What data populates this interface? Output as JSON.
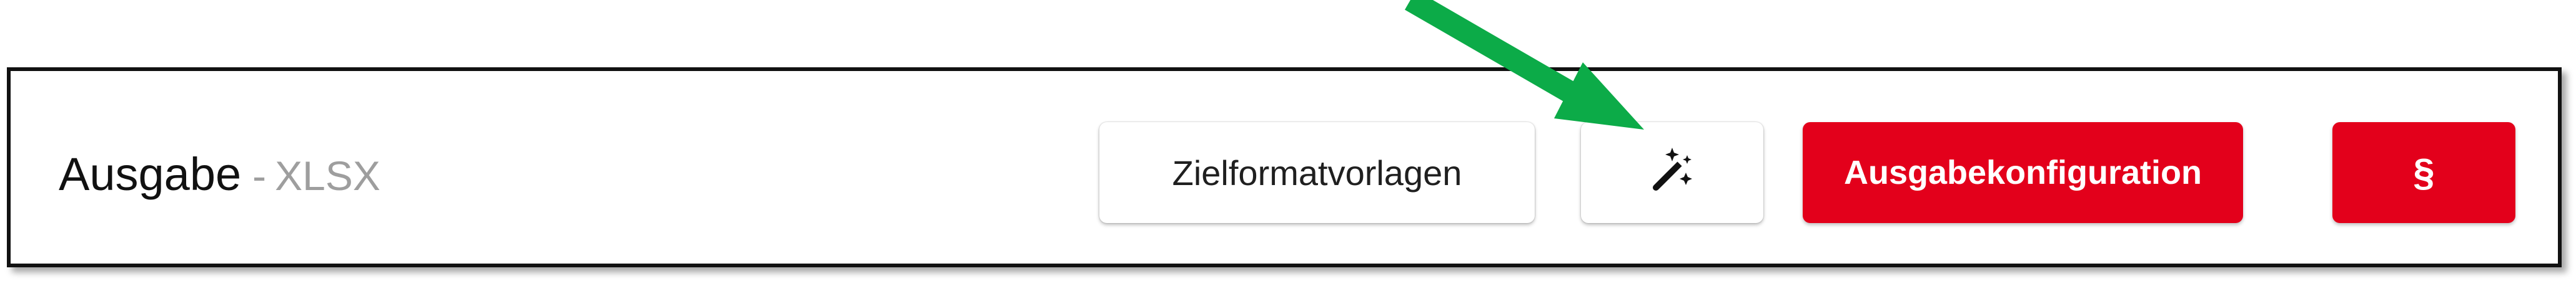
{
  "output_panel": {
    "title": "Ausgabe",
    "separator": "-",
    "format": "XLSX"
  },
  "buttons": {
    "templates_label": "Zielformatvorlagen",
    "wand_icon": "magic-wand-icon",
    "config_label": "Ausgabekonfiguration",
    "legal_label": "§"
  },
  "annotation": {
    "arrow_color": "#0cab48",
    "points_to": "magic-wand-button"
  },
  "colors": {
    "accent_red": "#e3001b",
    "muted_text": "#9e9e9e"
  }
}
